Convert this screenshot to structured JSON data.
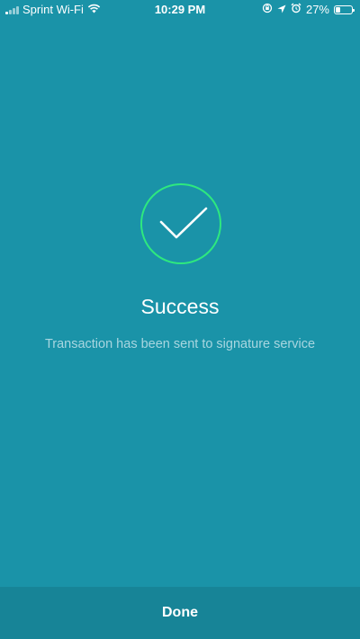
{
  "status_bar": {
    "carrier": "Sprint Wi-Fi",
    "time": "10:29 PM",
    "battery_percent": "27%",
    "battery_level": 0.27,
    "icons": [
      "signal-icon",
      "wifi-icon",
      "screen-rotation-lock-icon",
      "location-icon",
      "alarm-icon",
      "battery-icon"
    ]
  },
  "result": {
    "icon": "checkmark-icon",
    "accent_color": "#2ee87f",
    "title": "Success",
    "message": "Transaction has been sent to signature service"
  },
  "footer": {
    "done_label": "Done"
  },
  "colors": {
    "background": "#1a93a8",
    "footer_background": "#178497"
  }
}
